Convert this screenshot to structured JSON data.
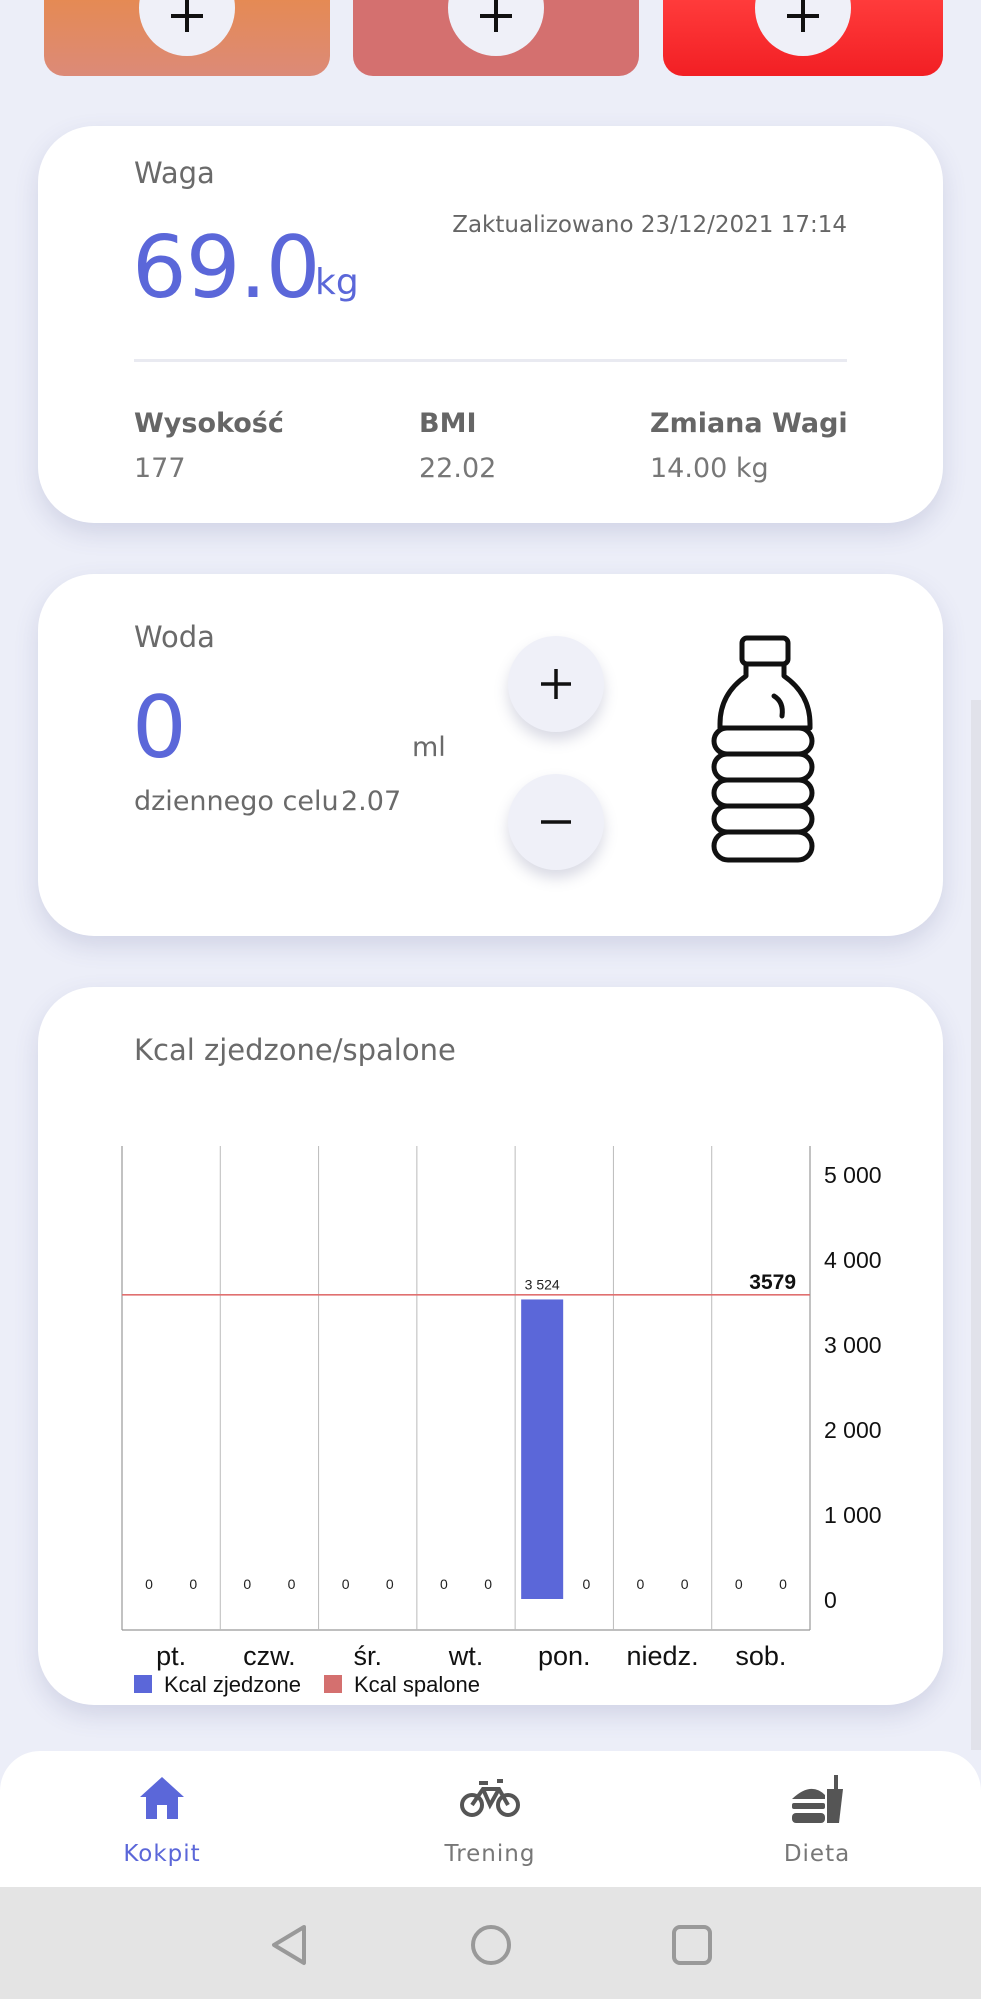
{
  "top_tiles": [
    {
      "color": "#e58a54",
      "icon": "plus-icon"
    },
    {
      "color": "#d4706f",
      "icon": "plus-icon"
    },
    {
      "color": "#f21f24",
      "icon": "plus-icon"
    }
  ],
  "weight": {
    "title": "Waga",
    "value": "69.0",
    "unit": "kg",
    "updated": "Zaktualizowano 23/12/2021 17:14",
    "stats": [
      {
        "label": "Wysokość",
        "value": "177"
      },
      {
        "label": "BMI",
        "value": "22.02"
      },
      {
        "label": "Zmiana Wagi",
        "value": "14.00 kg"
      }
    ]
  },
  "water": {
    "title": "Woda",
    "value": "0",
    "unit": "ml",
    "goal_label": "dziennego celu",
    "goal_value": "2.07",
    "icon": "bottle-icon"
  },
  "kcal": {
    "title": "Kcal zjedzone/spalone"
  },
  "chart_data": {
    "type": "bar",
    "categories": [
      "pt.",
      "czw.",
      "śr.",
      "wt.",
      "pon.",
      "niedz.",
      "sob."
    ],
    "series": [
      {
        "name": "Kcal zjedzone",
        "color": "#5b67d9",
        "values": [
          0,
          0,
          0,
          0,
          3524,
          0,
          0
        ],
        "labels": [
          "0",
          "0",
          "0",
          "0",
          "3 524",
          "0",
          "0"
        ]
      },
      {
        "name": "Kcal spalone",
        "color": "#d4706f",
        "values": [
          0,
          0,
          0,
          0,
          0,
          0,
          0
        ],
        "labels": [
          "0",
          "0",
          "0",
          "0",
          "0",
          "0",
          "0"
        ]
      }
    ],
    "ylim": [
      0,
      5000
    ],
    "yticks": [
      0,
      1000,
      2000,
      3000,
      4000,
      5000
    ],
    "ytick_labels": [
      "0",
      "1 000",
      "2 000",
      "3 000",
      "4 000",
      "5 000"
    ],
    "y_axis_position": "right",
    "target_line": {
      "value": 3579,
      "label": "3579",
      "color": "#e07070"
    },
    "legend_position": "bottom-left"
  },
  "nav": {
    "items": [
      {
        "label": "Kokpit",
        "icon": "home-icon",
        "active": true
      },
      {
        "label": "Trening",
        "icon": "bicycle-icon",
        "active": false
      },
      {
        "label": "Dieta",
        "icon": "food-icon",
        "active": false
      }
    ]
  },
  "system_bar": {
    "buttons": [
      "back-icon",
      "home-circle-icon",
      "recents-icon"
    ]
  },
  "colors": {
    "accent": "#5b67d9",
    "background": "#eceef8"
  }
}
